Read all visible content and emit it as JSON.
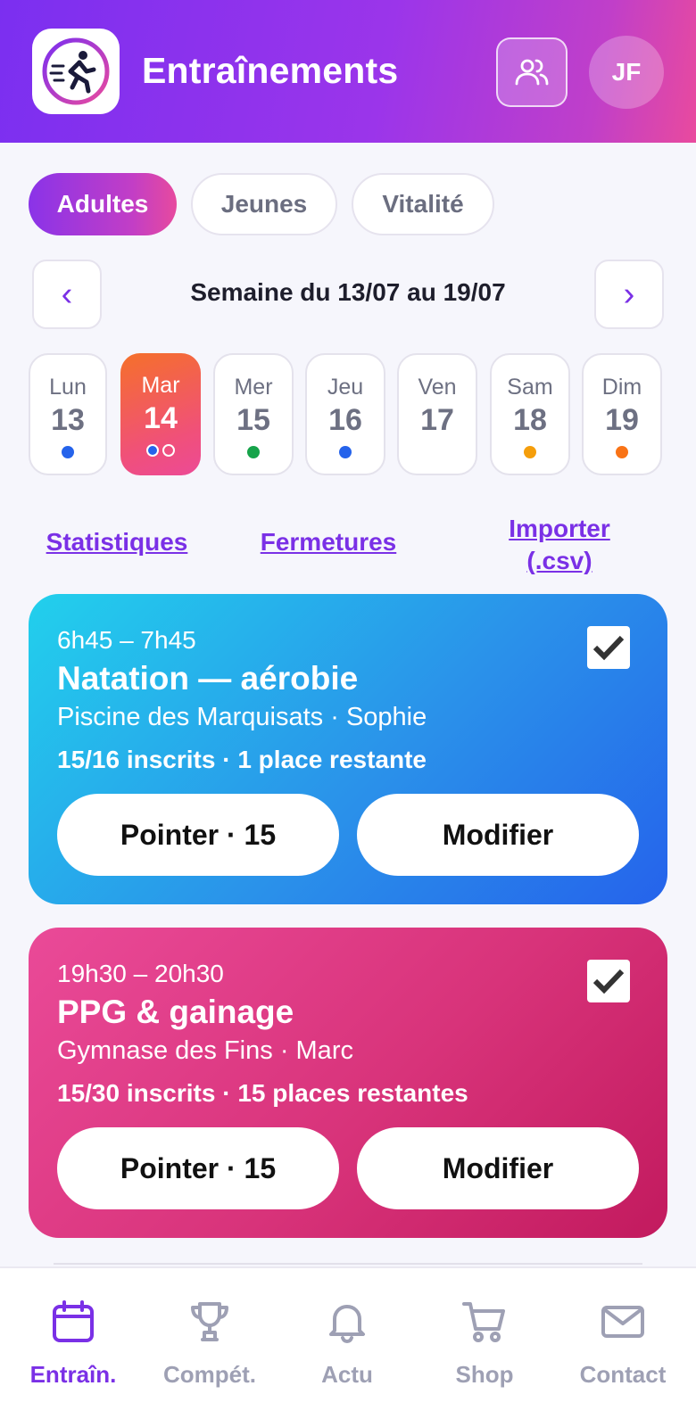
{
  "header": {
    "title": "Entraînements",
    "avatar_initials": "JF"
  },
  "categories": [
    {
      "label": "Adultes",
      "active": true
    },
    {
      "label": "Jeunes",
      "active": false
    },
    {
      "label": "Vitalité",
      "active": false
    }
  ],
  "week": {
    "prev": "‹",
    "next": "›",
    "label": "Semaine du 13/07 au 19/07"
  },
  "days": [
    {
      "name": "Lun",
      "num": "13",
      "dots": [
        "#2563eb"
      ]
    },
    {
      "name": "Mar",
      "num": "14",
      "selected": true,
      "dots": [
        "#2563eb",
        "outline"
      ]
    },
    {
      "name": "Mer",
      "num": "15",
      "dots": [
        "#16a34a"
      ]
    },
    {
      "name": "Jeu",
      "num": "16",
      "dots": [
        "#2563eb"
      ]
    },
    {
      "name": "Ven",
      "num": "17",
      "dots": []
    },
    {
      "name": "Sam",
      "num": "18",
      "dots": [
        "#f59e0b"
      ]
    },
    {
      "name": "Dim",
      "num": "19",
      "dots": [
        "#f97316"
      ]
    }
  ],
  "links": {
    "stats": "Statistiques",
    "closures": "Fermetures",
    "import_line1": "Importer",
    "import_line2": "(.csv)"
  },
  "sessions": [
    {
      "time": "6h45 – 7h45",
      "title": "Natation — aérobie",
      "place": "Piscine des Marquisats · Sophie",
      "count": "15/16 inscrits · 1 place restante",
      "checked": true,
      "pointer_label": "Pointer · 15",
      "edit_label": "Modifier"
    },
    {
      "time": "19h30 – 20h30",
      "title": "PPG & gainage",
      "place": "Gymnase des Fins · Marc",
      "count": "15/30 inscrits · 15 places restantes",
      "checked": true,
      "pointer_label": "Pointer · 15",
      "edit_label": "Modifier"
    }
  ],
  "bottom_nav": [
    {
      "label": "Entraîn.",
      "icon": "calendar-icon",
      "active": true
    },
    {
      "label": "Compét.",
      "icon": "trophy-icon",
      "active": false
    },
    {
      "label": "Actu",
      "icon": "bell-icon",
      "active": false
    },
    {
      "label": "Shop",
      "icon": "cart-icon",
      "active": false
    },
    {
      "label": "Contact",
      "icon": "mail-icon",
      "active": false
    }
  ],
  "colors": {
    "accent": "#7a30e6",
    "header_start": "#7b2ff0",
    "header_end": "#e94a9e",
    "card_blue": "#2a92ea",
    "card_pink": "#d8337a",
    "nav_inactive": "#9ea0b4"
  }
}
